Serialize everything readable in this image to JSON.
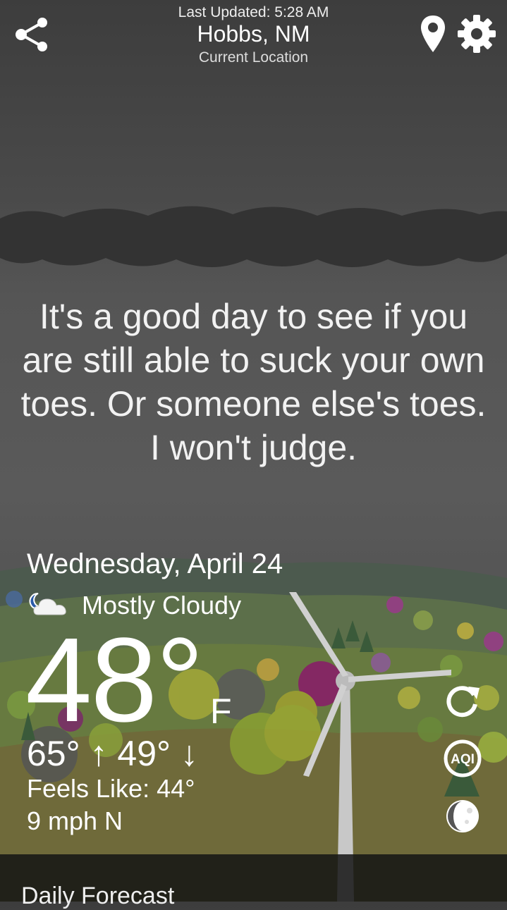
{
  "header": {
    "last_updated": "Last Updated: 5:28 AM",
    "city": "Hobbs, NM",
    "location_label": "Current Location"
  },
  "message": "It's a good day to see if you are still able to suck your own toes. Or someone else's toes. I won't judge.",
  "weather": {
    "date": "Wednesday, April 24",
    "condition": "Mostly Cloudy",
    "condition_icon": "partly-cloudy-night-icon",
    "temperature": "48°",
    "unit": "F",
    "hi_lo": "65° ↑ 49° ↓",
    "feels_like": "Feels Like: 44°",
    "wind": "9 mph N"
  },
  "side_buttons": {
    "refresh_icon": "refresh-icon",
    "aqi_label": "AQI",
    "moon_icon": "moon-phase-icon"
  },
  "daily": {
    "title": "Daily Forecast"
  },
  "colors": {
    "background": "#4a4a4a",
    "cloud": "#333333",
    "accent": "#ffffff"
  }
}
